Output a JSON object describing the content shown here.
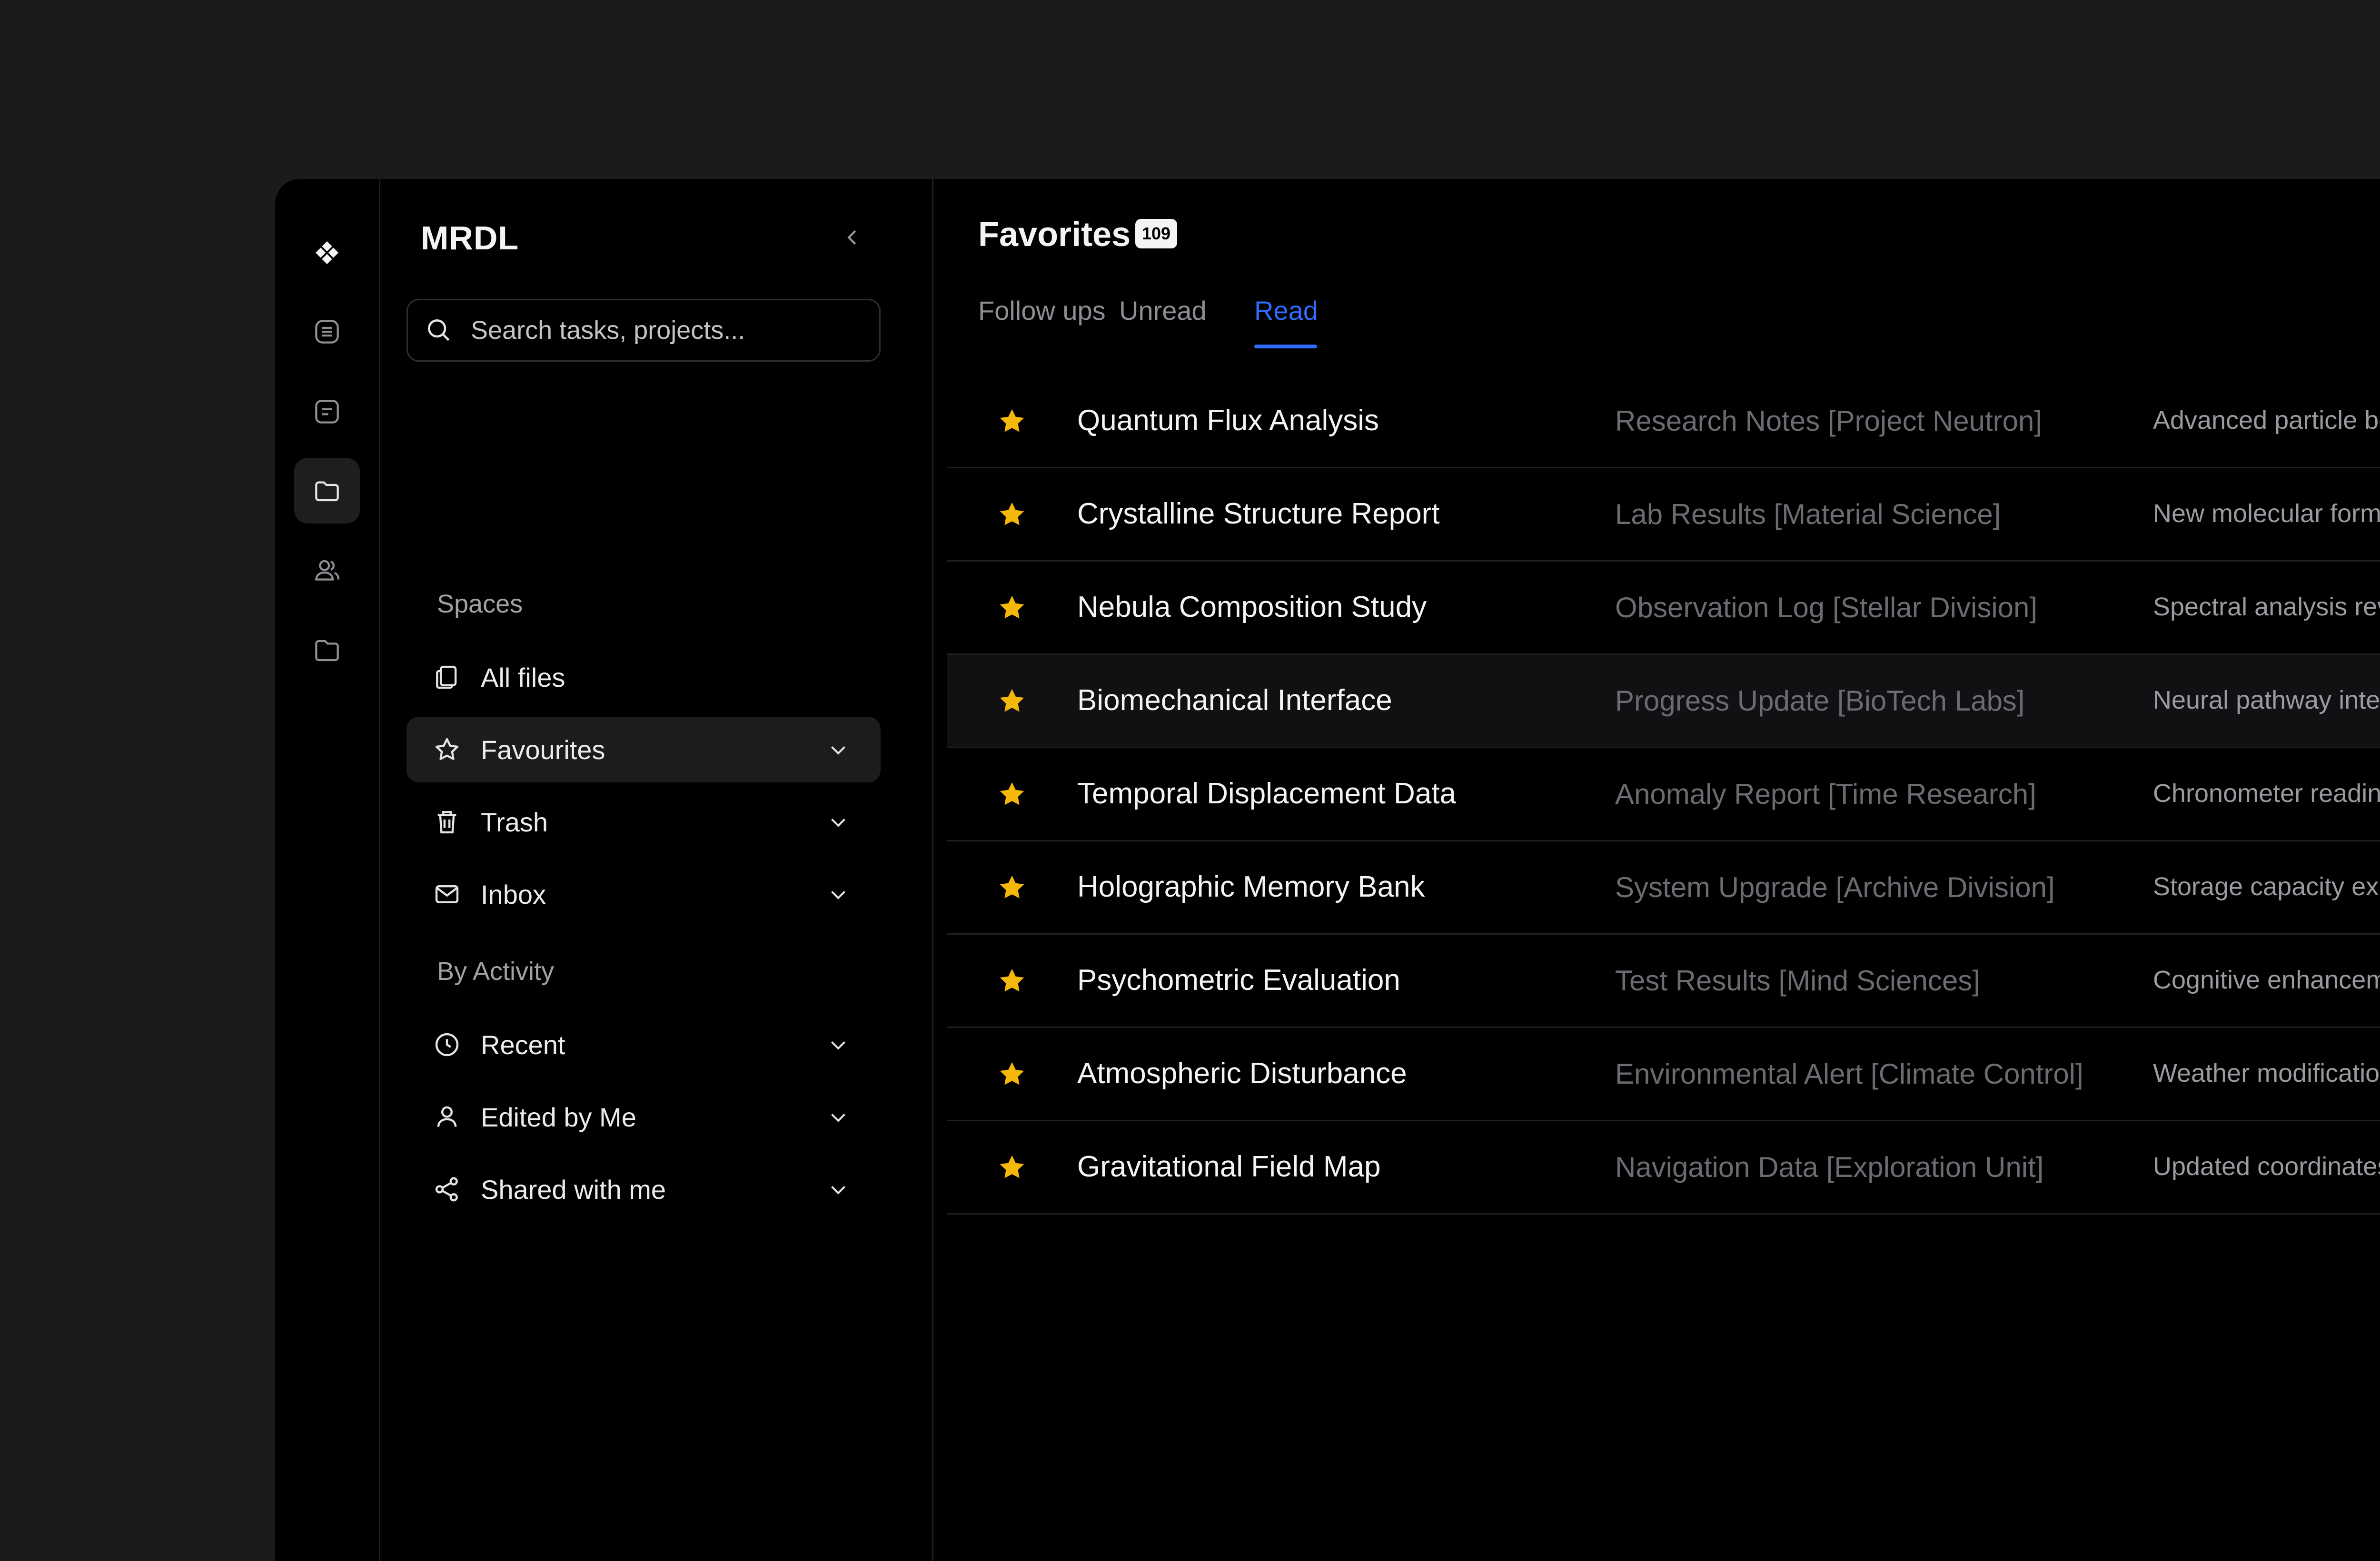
{
  "sidebar": {
    "brand": "MRDL",
    "search_placeholder": "Search tasks, projects...",
    "spaces_label": "Spaces",
    "activity_label": "By Activity",
    "items": [
      {
        "label": "All files",
        "icon": "files-icon"
      },
      {
        "label": "Favourites",
        "icon": "star-outline-icon"
      },
      {
        "label": "Trash",
        "icon": "trash-icon"
      },
      {
        "label": "Inbox",
        "icon": "mail-icon"
      },
      {
        "label": "Recent",
        "icon": "clock-icon"
      },
      {
        "label": "Edited by Me",
        "icon": "user-icon"
      },
      {
        "label": "Shared with me",
        "icon": "share-icon"
      }
    ]
  },
  "main": {
    "title": "Favorites",
    "count": "109",
    "tabs": [
      "Follow ups",
      "Unread",
      "Read"
    ],
    "active_tab": "Read",
    "accent": "#2f6bff",
    "star_color": "#f5b70a",
    "rows": [
      {
        "name": "Quantum Flux Analysis",
        "category": "Research Notes [Project Neutron]",
        "description": "Advanced particle behav"
      },
      {
        "name": "Crystalline Structure Report",
        "category": "Lab Results [Material Science]",
        "description": "New molecular formation"
      },
      {
        "name": "Nebula Composition Study",
        "category": "Observation Log [Stellar Division]",
        "description": "Spectral analysis reveals"
      },
      {
        "name": "Biomechanical Interface",
        "category": "Progress Update [BioTech Labs]",
        "description": "Neural pathway integrati"
      },
      {
        "name": "Temporal Displacement Data",
        "category": "Anomaly Report [Time Research]",
        "description": "Chronometer readings in"
      },
      {
        "name": "Holographic Memory Bank",
        "category": "System Upgrade [Archive Division]",
        "description": "Storage capacity expanc"
      },
      {
        "name": "Psychometric Evaluation",
        "category": "Test Results [Mind Sciences]",
        "description": "Cognitive enhancement p"
      },
      {
        "name": "Atmospheric Disturbance",
        "category": "Environmental Alert [Climate Control]",
        "description": "Weather modification sys"
      },
      {
        "name": "Gravitational Field Map",
        "category": "Navigation Data [Exploration Unit]",
        "description": "Updated coordinates for"
      }
    ]
  }
}
